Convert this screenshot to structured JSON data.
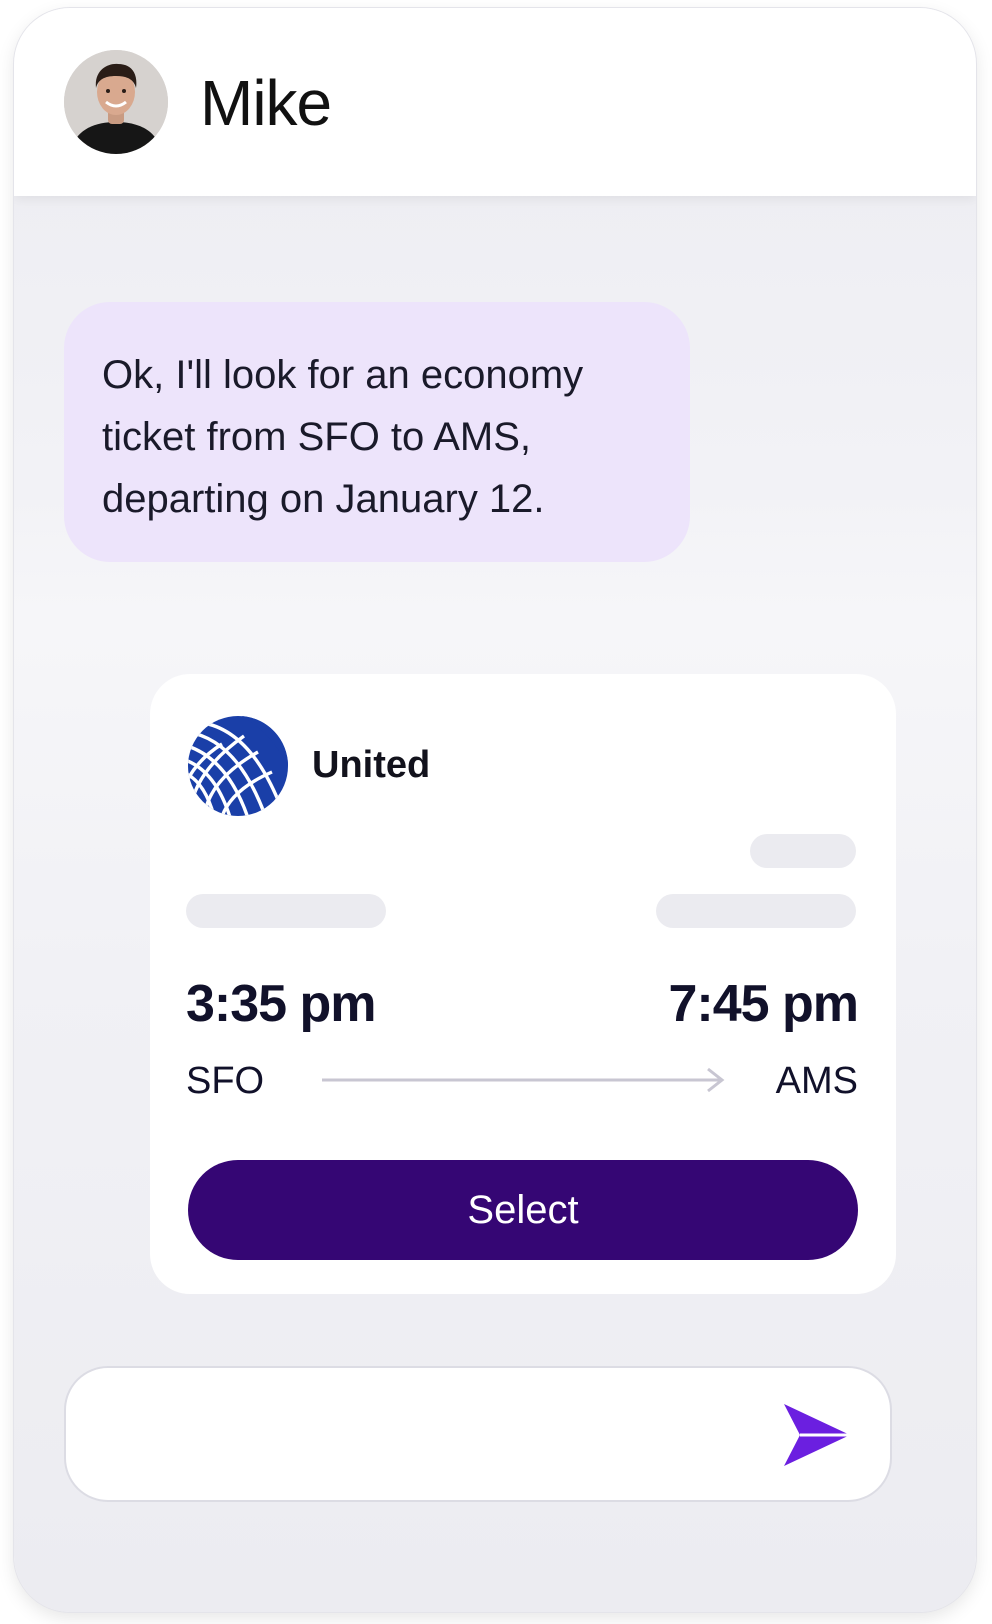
{
  "header": {
    "contact_name": "Mike",
    "avatar_icon": "person-avatar"
  },
  "message": {
    "lines": [
      "Ok, I'll look for an economy",
      "ticket from SFO to AMS,",
      "departing on January 12."
    ]
  },
  "flight_card": {
    "airline": "United",
    "logo_icon": "united-globe-logo",
    "departure": {
      "time": "3:35 pm",
      "code": "SFO"
    },
    "arrival": {
      "time": "7:45 pm",
      "code": "AMS"
    },
    "select_label": "Select"
  },
  "composer": {
    "placeholder": "",
    "send_icon": "send-icon"
  },
  "colors": {
    "bubble_bg": "#ede4fb",
    "button_bg": "#350674",
    "send_icon": "#6b1fe0",
    "logo_blue": "#1a3fa8"
  }
}
